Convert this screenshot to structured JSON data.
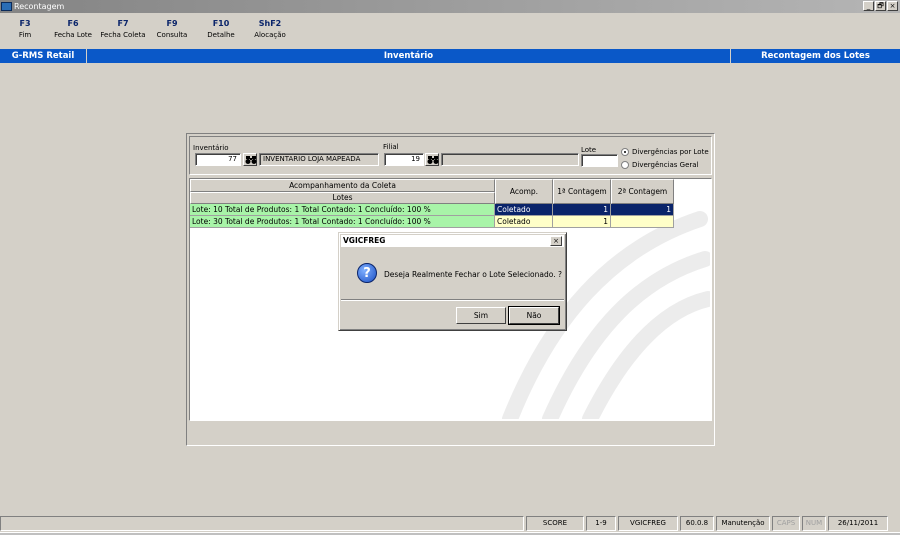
{
  "window": {
    "title": "Recontagem",
    "controls": [
      "_",
      "🗗",
      "×"
    ]
  },
  "toolbar": {
    "items": [
      {
        "key": "F3",
        "label": "Fim"
      },
      {
        "key": "F6",
        "label": "Fecha Lote"
      },
      {
        "key": "F7",
        "label": "Fecha Coleta"
      },
      {
        "key": "F9",
        "label": "Consulta"
      },
      {
        "key": "F10",
        "label": "Detalhe"
      },
      {
        "key": "ShF2",
        "label": "Alocação"
      }
    ]
  },
  "header": {
    "system": "G-RMS Retail",
    "module": "Inventário",
    "screen": "Recontagem dos Lotes"
  },
  "filter": {
    "inventario_label": "Inventário",
    "inventario_value": "77",
    "inventario_desc": "INVENTARIO LOJA MAPEADA",
    "filial_label": "Filial",
    "filial_value": "19",
    "filial_desc": "",
    "lote_label": "Lote",
    "lote_value": "",
    "radio_options": [
      {
        "label": "Divergências por Lote",
        "checked": true
      },
      {
        "label": "Divergências Geral",
        "checked": false
      }
    ]
  },
  "grid": {
    "group_header": "Acompanhamento da Coleta",
    "columns": [
      "Lotes",
      "Acomp.",
      "1ª Contagem",
      "2ª Contagem"
    ],
    "rows": [
      {
        "lotes": "Lote: 10 Total de Produtos: 1 Total Contado: 1 Concluído: 100 %",
        "acomp": "Coletado",
        "c1": "1",
        "c2": "1"
      },
      {
        "lotes": "Lote: 30 Total de Produtos: 1 Total Contado: 1 Concluído: 100 %",
        "acomp": "Coletado",
        "c1": "1",
        "c2": ""
      }
    ]
  },
  "dialog": {
    "title": "VGICFREG",
    "close": "×",
    "icon": "question-icon",
    "icon_glyph": "?",
    "message": "Deseja Realmente Fechar o Lote Selecionado. ?",
    "yes_label": "Sim",
    "no_label": "Não"
  },
  "statusbar": {
    "score": "SCORE",
    "range": "1-9",
    "program": "VGICFREG",
    "version": "60.0.8",
    "mode": "Manutenção",
    "caps": "CAPS",
    "num": "NUM",
    "date": "26/11/2011"
  },
  "colors": {
    "header_blue": "#0a58c8",
    "row_green": "#a8f4a8",
    "row_selected": "#0a246a",
    "row_yellow": "#ffffc8",
    "toolbar_key": "#0a246a"
  }
}
